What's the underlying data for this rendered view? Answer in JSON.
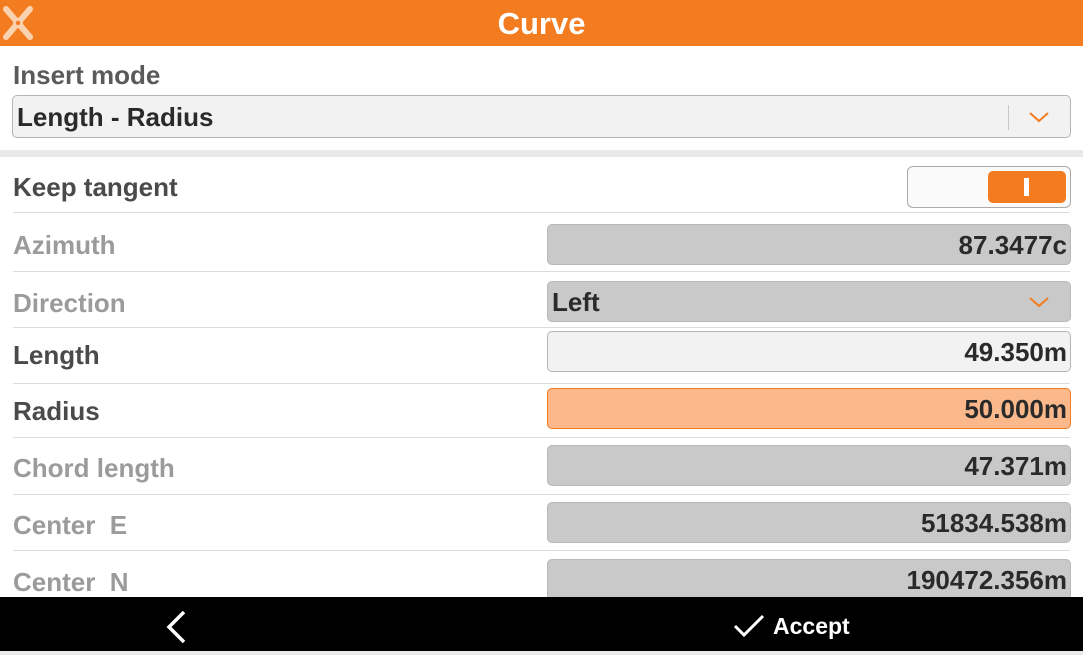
{
  "header": {
    "title": "Curve",
    "logo_icon": "x-logo-icon"
  },
  "insert_mode": {
    "label": "Insert mode",
    "value": "Length - Radius"
  },
  "form": {
    "keep_tangent": {
      "label": "Keep tangent",
      "enabled": true
    },
    "azimuth": {
      "label": "Azimuth",
      "value": "87.3477c"
    },
    "direction": {
      "label": "Direction",
      "value": "Left"
    },
    "length": {
      "label": "Length",
      "value": "49.350m"
    },
    "radius": {
      "label": "Radius",
      "value": "50.000m"
    },
    "chord_length": {
      "label": "Chord length",
      "value": "47.371m"
    },
    "center_e": {
      "label": "Center  E",
      "value": "51834.538m"
    },
    "center_n": {
      "label": "Center  N",
      "value": "190472.356m"
    }
  },
  "footer": {
    "back_icon": "chevron-left-icon",
    "accept_icon": "checkmark-icon",
    "accept_label": "Accept"
  },
  "colors": {
    "accent": "#f47c20",
    "focused_field": "#fbb98b",
    "readonly_field": "#c9c9c9",
    "bottom_bar": "#000000"
  }
}
